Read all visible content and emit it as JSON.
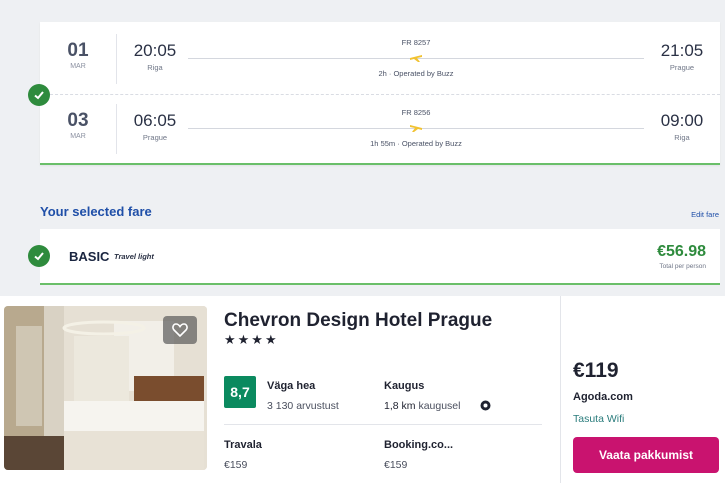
{
  "flights": {
    "legs": [
      {
        "day": "01",
        "month": "MAR",
        "dep_time": "20:05",
        "dep_city": "Riga",
        "flight_no": "FR 8257",
        "info": "2h · Operated by Buzz",
        "arr_time": "21:05",
        "arr_city": "Prague"
      },
      {
        "day": "03",
        "month": "MAR",
        "dep_time": "06:05",
        "dep_city": "Prague",
        "flight_no": "FR 8256",
        "info": "1h 55m · Operated by Buzz",
        "arr_time": "09:00",
        "arr_city": "Riga"
      }
    ]
  },
  "fare": {
    "section_title": "Your selected fare",
    "edit_label": "Edit fare",
    "name": "BASIC",
    "subtitle": "Travel light",
    "price": "€56.98",
    "price_note": "Total per person"
  },
  "hotel": {
    "name": "Chevron Design Hotel Prague",
    "stars": "★★★★",
    "score": "8,7",
    "rating_label": "Väga hea",
    "rating_count": "3 130 arvustust",
    "distance_label": "Kaugus",
    "distance_value": "1,8 km",
    "distance_unit": "kaugusel",
    "providers": [
      {
        "name": "Travala",
        "price": "€159"
      },
      {
        "name": "Booking.co...",
        "price": "€159"
      }
    ],
    "best_price": "€119",
    "best_provider": "Agoda.com",
    "best_extra": "Tasuta Wifi",
    "deal_button": "Vaata pakkumist"
  },
  "colors": {
    "accent_blue": "#1f4fa8",
    "success_green": "#2e8b3d",
    "score_green": "#0b8a5f",
    "deal_magenta": "#c9136f"
  }
}
